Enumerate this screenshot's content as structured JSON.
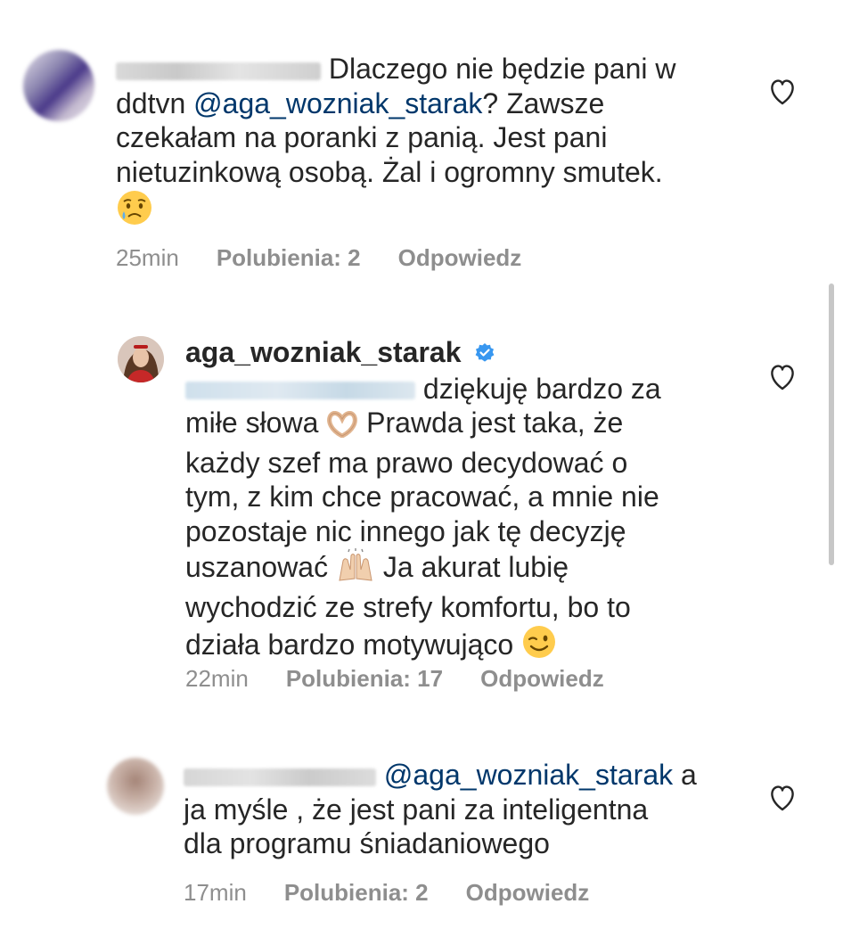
{
  "comments": [
    {
      "text_after_name": "Dlaczego nie będzie pani w",
      "line2_start": "ddtvn ",
      "mention": "@aga_wozniak_starak",
      "line2_end": "? Zawsze",
      "line3": "czekałam na poranki z panią. Jest pani",
      "line4": "nietuzinkową osobą. Żal i ogromny smutek.",
      "emoji": "crying-face-emoji",
      "time": "25min",
      "likes": "Polubienia: 2",
      "reply": "Odpowiedz"
    },
    {
      "username": "aga_wozniak_starak",
      "verified_icon": "verified-badge-icon",
      "line1": "dziękuję bardzo za",
      "line2": "miłe słowa",
      "line2b": "Prawda jest taka, że",
      "line3": "każdy szef ma prawo decydować o",
      "line4": "tym, z kim chce pracować, a mnie nie",
      "line5": "pozostaje nic innego jak tę decyzję",
      "line6": "uszanować",
      "line6b": "Ja akurat lubię",
      "line7": "wychodzić ze strefy komfortu, bo to",
      "line8": "działa bardzo motywująco",
      "time": "22min",
      "likes": "Polubienia: 17",
      "reply": "Odpowiedz"
    },
    {
      "mention": "@aga_wozniak_starak",
      "mention_after": " a",
      "line2": "ja myśle , że jest pani za inteligentna",
      "line3": "dla programu śniadaniowego",
      "time": "17min",
      "likes": "Polubienia: 2",
      "reply": "Odpowiedz"
    }
  ],
  "colors": {
    "text": "#262626",
    "meta": "#8e8e8e",
    "mention": "#00376b",
    "verified": "#3897f0",
    "scrollbar": "#c7c7c7"
  }
}
